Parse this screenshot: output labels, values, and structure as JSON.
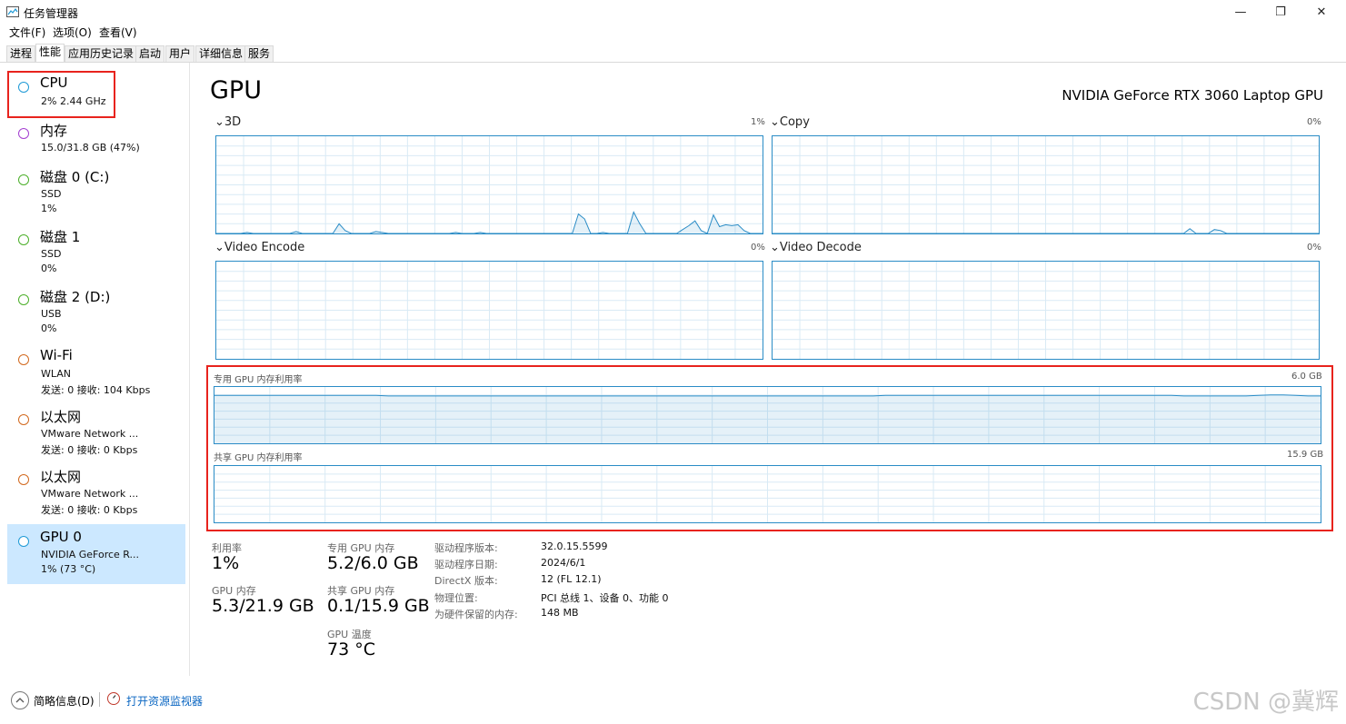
{
  "window": {
    "title": "任务管理器",
    "controls": [
      "—",
      "❐",
      "✕"
    ]
  },
  "menu": [
    "文件(F)",
    "选项(O)",
    "查看(V)"
  ],
  "tabs": [
    "进程",
    "性能",
    "应用历史记录",
    "启动",
    "用户",
    "详细信息",
    "服务"
  ],
  "active_tab": "性能",
  "sidebar": [
    {
      "title": "CPU",
      "lines": [
        "2% 2.44 GHz"
      ],
      "color": "#1f9ad6"
    },
    {
      "title": "内存",
      "lines": [
        "15.0/31.8 GB (47%)"
      ],
      "color": "#a43fd1"
    },
    {
      "title": "磁盘 0 (C:)",
      "lines": [
        "SSD",
        "1%"
      ],
      "color": "#4caf2a"
    },
    {
      "title": "磁盘 1",
      "lines": [
        "SSD",
        "0%"
      ],
      "color": "#4caf2a"
    },
    {
      "title": "磁盘 2 (D:)",
      "lines": [
        "USB",
        "0%"
      ],
      "color": "#4caf2a"
    },
    {
      "title": "Wi-Fi",
      "lines": [
        "WLAN",
        "发送: 0 接收: 104 Kbps"
      ],
      "color": "#d2691e"
    },
    {
      "title": "以太网",
      "lines": [
        "VMware Network ...",
        "发送: 0 接收: 0 Kbps"
      ],
      "color": "#d2691e"
    },
    {
      "title": "以太网",
      "lines": [
        "VMware Network ...",
        "发送: 0 接收: 0 Kbps"
      ],
      "color": "#d2691e"
    },
    {
      "title": "GPU 0",
      "lines": [
        "NVIDIA GeForce R...",
        "1% (73 °C)"
      ],
      "color": "#1f9ad6"
    }
  ],
  "main": {
    "title": "GPU",
    "device": "NVIDIA GeForce RTX 3060 Laptop GPU",
    "graphs": [
      {
        "label": "3D",
        "pct": "1%"
      },
      {
        "label": "Copy",
        "pct": "0%"
      },
      {
        "label": "Video Encode",
        "pct": "0%"
      },
      {
        "label": "Video Decode",
        "pct": "0%"
      }
    ],
    "dedicated_mem": {
      "label": "专用 GPU 内存利用率",
      "max": "6.0 GB"
    },
    "shared_mem": {
      "label": "共享 GPU 内存利用率",
      "max": "15.9 GB"
    }
  },
  "stats": {
    "util_label": "利用率",
    "util_value": "1%",
    "ded_label": "专用 GPU 内存",
    "ded_value": "5.2/6.0 GB",
    "gpumem_label": "GPU 内存",
    "gpumem_value": "5.3/21.9 GB",
    "shared_label": "共享 GPU 内存",
    "shared_value": "0.1/15.9 GB",
    "temp_label": "GPU 温度",
    "temp_value": "73 °C"
  },
  "details": [
    {
      "key": "驱动程序版本:",
      "value": "32.0.15.5599"
    },
    {
      "key": "驱动程序日期:",
      "value": "2024/6/1"
    },
    {
      "key": "DirectX 版本:",
      "value": "12 (FL 12.1)"
    },
    {
      "key": "物理位置:",
      "value": "PCI 总线 1、设备 0、功能 0"
    },
    {
      "key": "为硬件保留的内存:",
      "value": "148 MB"
    }
  ],
  "bottom": {
    "fewer_details": "简略信息(D)",
    "resource_monitor": "打开资源监视器"
  },
  "watermark": "CSDN @冀辉",
  "graph_data": {
    "3d": [
      0,
      0,
      0,
      0,
      0,
      1,
      0,
      0,
      0,
      0,
      0,
      0,
      0,
      2,
      0,
      0,
      0,
      0,
      0,
      0,
      10,
      3,
      0,
      0,
      0,
      0,
      2,
      1,
      0,
      0,
      0,
      0,
      0,
      0,
      0,
      0,
      0,
      0,
      0,
      1,
      0,
      0,
      0,
      1,
      0,
      0,
      0,
      0,
      0,
      0,
      0,
      0,
      0,
      0,
      0,
      0,
      0,
      0,
      0,
      20,
      15,
      0,
      0,
      1,
      0,
      0,
      0,
      0,
      22,
      10,
      0,
      0,
      0,
      0,
      0,
      0,
      4,
      8,
      13,
      3,
      0,
      19,
      7,
      9,
      8,
      9,
      3,
      0,
      0,
      0
    ],
    "copy": [
      0,
      0,
      0,
      0,
      0,
      0,
      0,
      0,
      0,
      0,
      0,
      0,
      0,
      0,
      0,
      0,
      0,
      0,
      0,
      0,
      0,
      0,
      0,
      0,
      0,
      0,
      0,
      0,
      0,
      0,
      0,
      0,
      0,
      0,
      0,
      0,
      0,
      0,
      0,
      0,
      0,
      0,
      0,
      0,
      0,
      0,
      0,
      0,
      0,
      0,
      0,
      0,
      0,
      0,
      0,
      0,
      0,
      0,
      0,
      0,
      0,
      0,
      0,
      0,
      0,
      0,
      0,
      0,
      5,
      0,
      0,
      0,
      4,
      3,
      0,
      0,
      0,
      0,
      0,
      0,
      0,
      0,
      0,
      0,
      0,
      0,
      0,
      0,
      0,
      0
    ],
    "dedicated": [
      85,
      85,
      85,
      85,
      85,
      85,
      85,
      85,
      85,
      85,
      85,
      85,
      85,
      85,
      84,
      84,
      84,
      84,
      84,
      84,
      84,
      84,
      84,
      84,
      84,
      84,
      84,
      84,
      84,
      84,
      84,
      84,
      84,
      84,
      84,
      84,
      84,
      84,
      84,
      84,
      84,
      84,
      84,
      84,
      84,
      84,
      84,
      84,
      84,
      84,
      84,
      84,
      84,
      84,
      85,
      85,
      85,
      85,
      85,
      85,
      85,
      85,
      85,
      85,
      85,
      85,
      85,
      85,
      85,
      85,
      85,
      85,
      85,
      85,
      85,
      85,
      85,
      85,
      84,
      84,
      84,
      84,
      84,
      84,
      85,
      86,
      86,
      85,
      84,
      84
    ]
  }
}
